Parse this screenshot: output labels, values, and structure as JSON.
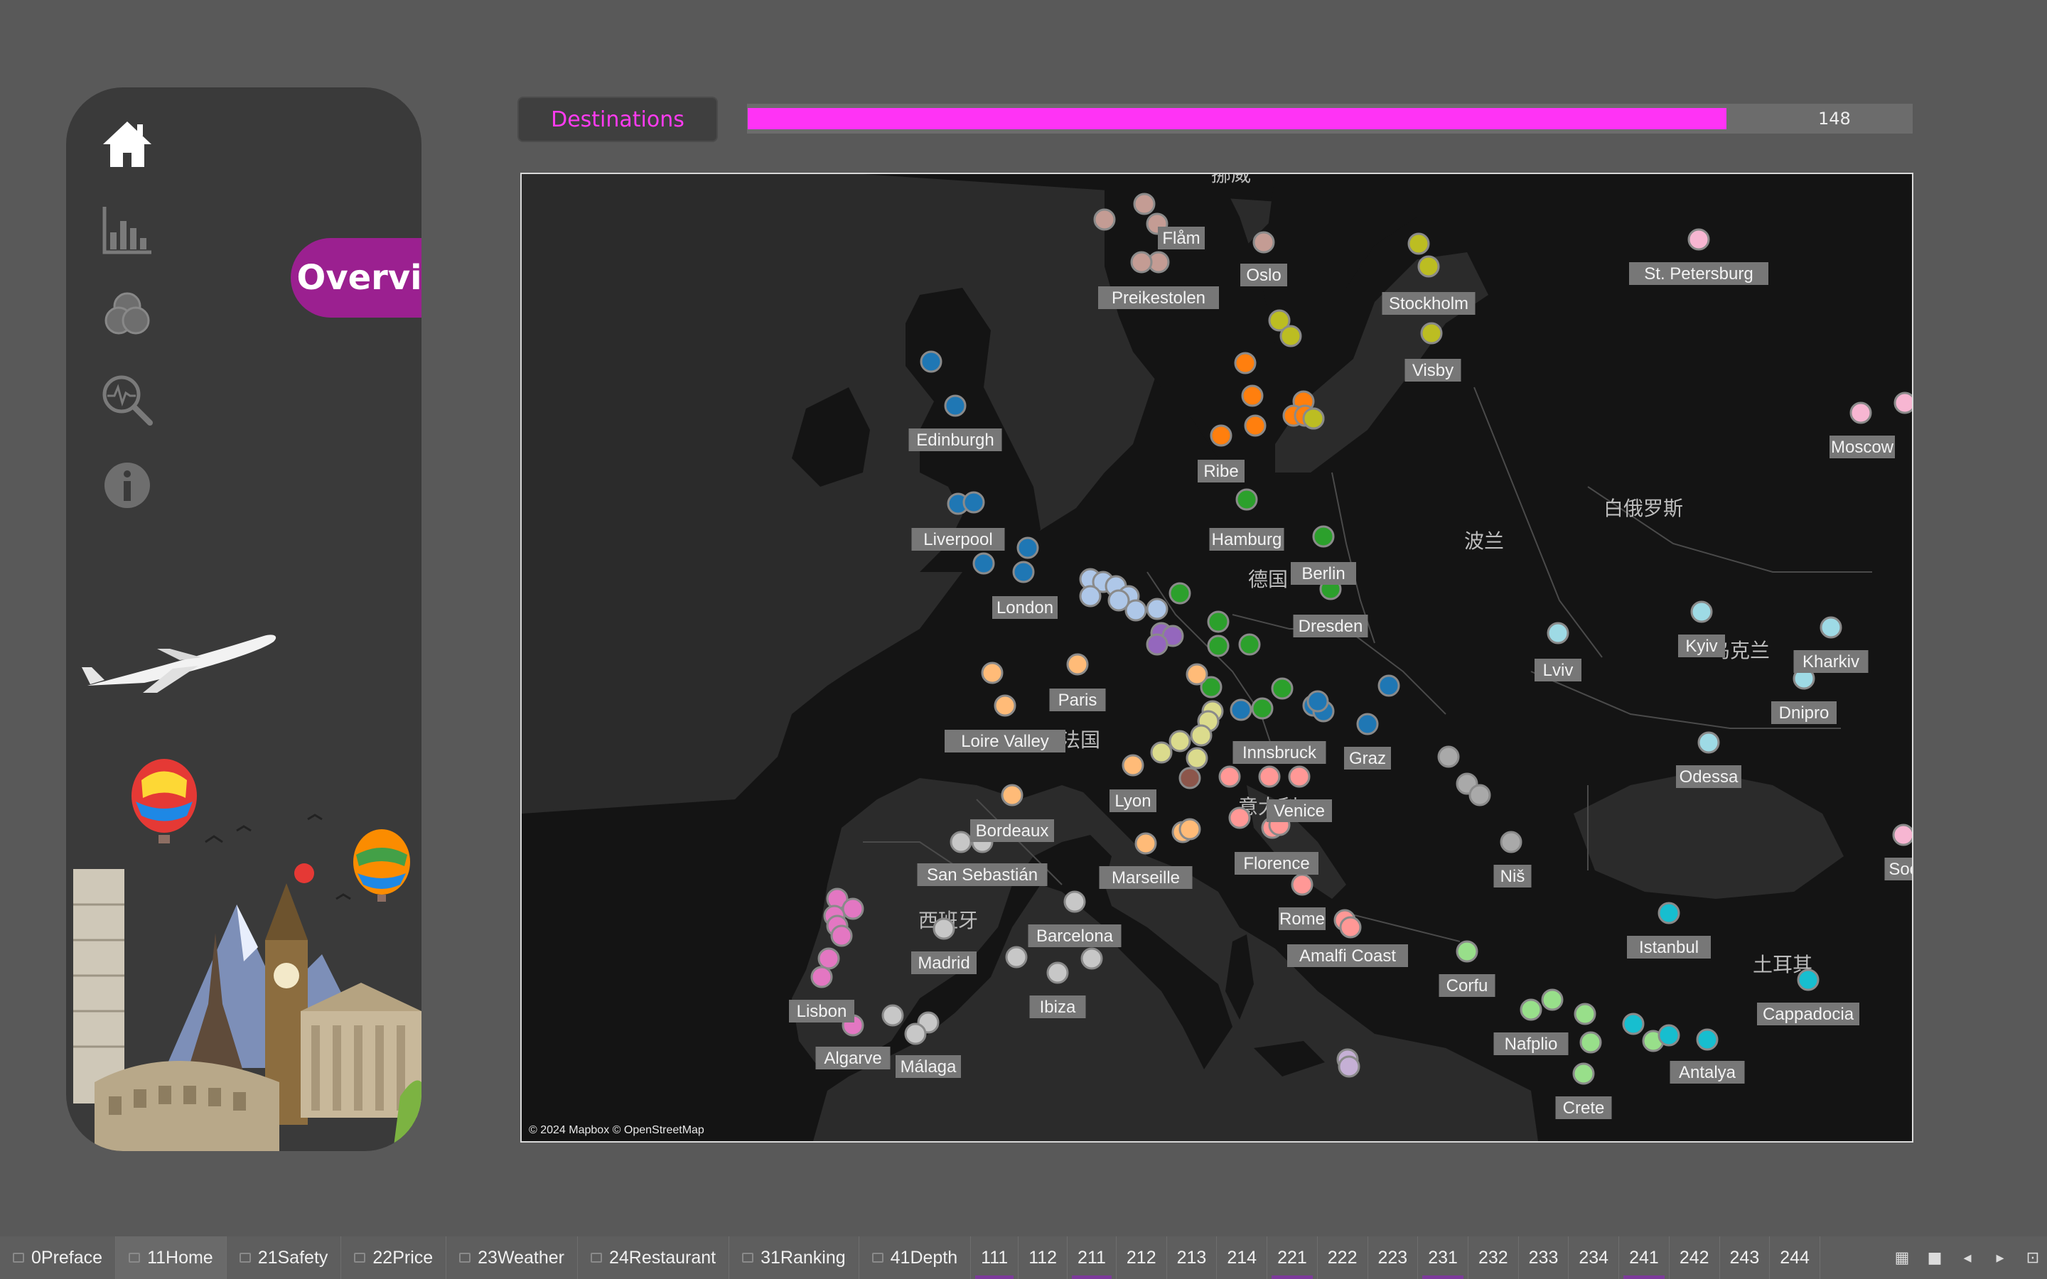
{
  "nav": {
    "items": [
      {
        "icon": "home-icon",
        "active": true
      },
      {
        "icon": "bar-chart-icon",
        "active": false
      },
      {
        "icon": "venn-circles-icon",
        "active": false
      },
      {
        "icon": "magnifier-pulse-icon",
        "active": false
      },
      {
        "icon": "info-icon",
        "active": false
      }
    ],
    "overview_label": "Overview"
  },
  "top_bar": {
    "destinations_label": "Destinations",
    "progress_value": "148",
    "progress_fraction": 0.919
  },
  "map": {
    "attribution": "© 2024 Mapbox © OpenStreetMap",
    "country_labels": [
      "挪威",
      "德国",
      "法国",
      "波兰",
      "白俄罗斯",
      "乌克兰",
      "西班牙",
      "意大利",
      "土耳其"
    ],
    "city_labels": [
      "Flåm",
      "Preikestolen",
      "Oslo",
      "Stockholm",
      "Visby",
      "St. Petersburg",
      "Moscow",
      "Edinburgh",
      "Ribe",
      "Liverpool",
      "Hamburg",
      "Berlin",
      "London",
      "Dresden",
      "Paris",
      "Lviv",
      "Kyiv",
      "Kharkiv",
      "Dnipro",
      "Loire Valley",
      "Innsbruck",
      "Graz",
      "Odessa",
      "Lyon",
      "Venice",
      "Bordeaux",
      "San Sebastián",
      "Marseille",
      "Florence",
      "Niš",
      "Soc",
      "Barcelona",
      "Rome",
      "Istanbul",
      "Madrid",
      "Amalfi Coast",
      "Corfu",
      "Ibiza",
      "Cappadocia",
      "Lisbon",
      "Nafplio",
      "Algarve",
      "Málaga",
      "Antalya",
      "Crete"
    ],
    "marker_colors": {
      "norway": "#c9a3a0",
      "sweden": "#bcbd22",
      "russia": "#f7b6d2",
      "uk": "#1f77b4",
      "denmark": "#ff7f0e",
      "germany": "#2ca02c",
      "benelux": "#aec7e8",
      "purple": "#9467bd",
      "france": "#ffbb78",
      "alps": "#dbdb8d",
      "brown": "#8c564b",
      "italy": "#ff9896",
      "balkans": "#a9a9a9",
      "spain": "#c7c7c7",
      "portugal": "#e377c2",
      "greece": "#98df8a",
      "ukraine": "#9edae5",
      "turkey": "#17becf",
      "malta": "#c5b0d5"
    }
  },
  "tabs": [
    {
      "label": "0Preface",
      "glyph": true,
      "active": false
    },
    {
      "label": "11Home",
      "glyph": true,
      "active": true
    },
    {
      "label": "21Safety",
      "glyph": true,
      "active": false
    },
    {
      "label": "22Price",
      "glyph": true,
      "active": false
    },
    {
      "label": "23Weather",
      "glyph": true,
      "active": false
    },
    {
      "label": "24Restaurant",
      "glyph": true,
      "active": false
    },
    {
      "label": "31Ranking",
      "glyph": true,
      "active": false
    },
    {
      "label": "41Depth",
      "glyph": true,
      "active": false
    },
    {
      "label": "111",
      "glyph": false,
      "marked": true
    },
    {
      "label": "112",
      "glyph": false
    },
    {
      "label": "211",
      "glyph": false,
      "marked": true
    },
    {
      "label": "212",
      "glyph": false
    },
    {
      "label": "213",
      "glyph": false
    },
    {
      "label": "214",
      "glyph": false
    },
    {
      "label": "221",
      "glyph": false,
      "marked": true
    },
    {
      "label": "222",
      "glyph": false
    },
    {
      "label": "223",
      "glyph": false
    },
    {
      "label": "231",
      "glyph": false,
      "marked": true
    },
    {
      "label": "232",
      "glyph": false
    },
    {
      "label": "233",
      "glyph": false
    },
    {
      "label": "234",
      "glyph": false
    },
    {
      "label": "241",
      "glyph": false,
      "marked": true
    },
    {
      "label": "242",
      "glyph": false
    },
    {
      "label": "243",
      "glyph": false
    },
    {
      "label": "244",
      "glyph": false
    }
  ]
}
